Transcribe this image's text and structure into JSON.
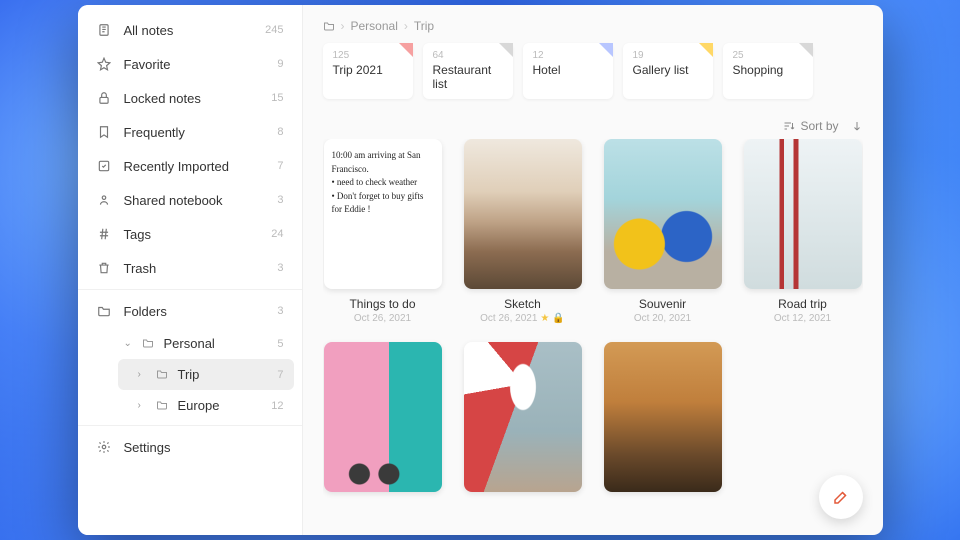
{
  "sidebar": {
    "items": [
      {
        "icon": "note",
        "label": "All notes",
        "count": 245
      },
      {
        "icon": "star",
        "label": "Favorite",
        "count": 9
      },
      {
        "icon": "lock",
        "label": "Locked notes",
        "count": 15
      },
      {
        "icon": "bookmark",
        "label": "Frequently",
        "count": 8
      },
      {
        "icon": "import",
        "label": "Recently Imported",
        "count": 7
      },
      {
        "icon": "share",
        "label": "Shared notebook",
        "count": 3
      },
      {
        "icon": "tag",
        "label": "Tags",
        "count": 24
      },
      {
        "icon": "trash",
        "label": "Trash",
        "count": 3
      }
    ],
    "folders_label": "Folders",
    "folders_count": 3,
    "folder_tree": {
      "name": "Personal",
      "count": 5,
      "children": [
        {
          "name": "Trip",
          "count": 7,
          "active": true
        },
        {
          "name": "Europe",
          "count": 12
        }
      ]
    },
    "settings_label": "Settings"
  },
  "breadcrumb": [
    "Personal",
    "Trip"
  ],
  "chips": [
    {
      "count": 125,
      "title": "Trip 2021",
      "accent": "#f6a0a0"
    },
    {
      "count": 64,
      "title": "Restaurant list",
      "accent": "#d8d8d8"
    },
    {
      "count": 12,
      "title": "Hotel",
      "accent": "#b8c6ff"
    },
    {
      "count": 19,
      "title": "Gallery list",
      "accent": "#ffd866"
    },
    {
      "count": 25,
      "title": "Shopping",
      "accent": "#d8d8d8"
    }
  ],
  "sort_label": "Sort by",
  "notes": [
    {
      "name": "Things to do",
      "date": "Oct 26, 2021",
      "thumb": "todo",
      "text": "10:00 am arriving at San Francisco.\n• need to check weather\n• Don't forget to buy gifts for Eddie !"
    },
    {
      "name": "Sketch",
      "date": "Oct 26, 2021",
      "thumb": "sketch",
      "starred": true,
      "locked": true
    },
    {
      "name": "Souvenir",
      "date": "Oct 20, 2021",
      "thumb": "souvenir"
    },
    {
      "name": "Road trip",
      "date": "Oct 12, 2021",
      "thumb": "roadtrip"
    },
    {
      "name": "",
      "date": "",
      "thumb": "bike"
    },
    {
      "name": "",
      "date": "",
      "thumb": "carousel"
    },
    {
      "name": "",
      "date": "",
      "thumb": "city"
    }
  ]
}
